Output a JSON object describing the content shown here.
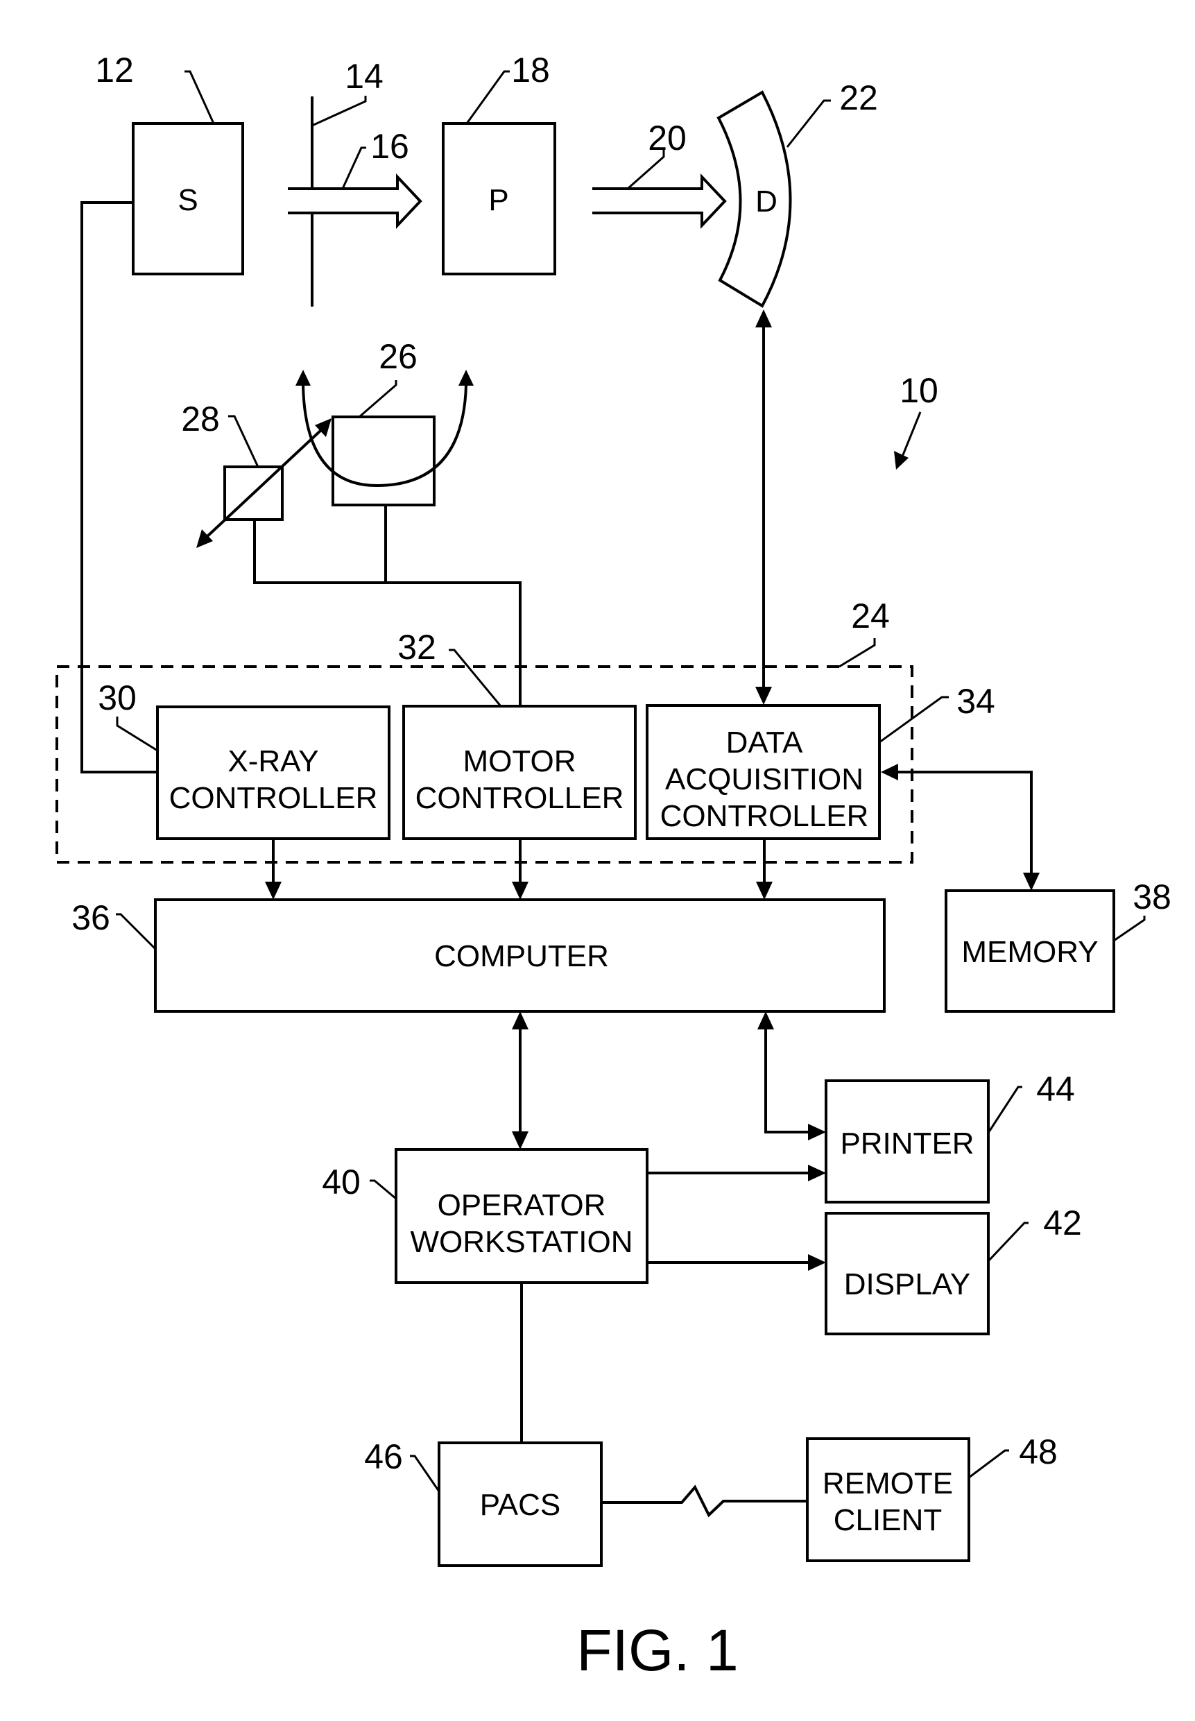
{
  "figure": {
    "caption": "FIG. 1",
    "system_ref": "10"
  },
  "components": {
    "source": {
      "label": "S",
      "ref": "12"
    },
    "collimator": {
      "ref": "14"
    },
    "beam_in": {
      "ref": "16"
    },
    "patient": {
      "label": "P",
      "ref": "18"
    },
    "beam_out": {
      "ref": "20"
    },
    "detector": {
      "label": "D",
      "ref": "22"
    },
    "control_mechanism": {
      "ref": "24"
    },
    "rotational_subsystem": {
      "ref": "26"
    },
    "linear_positioning_subsystem": {
      "ref": "28"
    },
    "xray_controller": {
      "line1": "X-RAY",
      "line2": "CONTROLLER",
      "ref": "30"
    },
    "motor_controller": {
      "line1": "MOTOR",
      "line2": "CONTROLLER",
      "ref": "32"
    },
    "daq_controller": {
      "line1": "DATA",
      "line2": "ACQUISITION",
      "line3": "CONTROLLER",
      "ref": "34"
    },
    "computer": {
      "label": "COMPUTER",
      "ref": "36"
    },
    "memory": {
      "label": "MEMORY",
      "ref": "38"
    },
    "operator_workstation": {
      "line1": "OPERATOR",
      "line2": "WORKSTATION",
      "ref": "40"
    },
    "display": {
      "label": "DISPLAY",
      "ref": "42"
    },
    "printer": {
      "label": "PRINTER",
      "ref": "44"
    },
    "pacs": {
      "label": "PACS",
      "ref": "46"
    },
    "remote_client": {
      "line1": "REMOTE",
      "line2": "CLIENT",
      "ref": "48"
    }
  }
}
